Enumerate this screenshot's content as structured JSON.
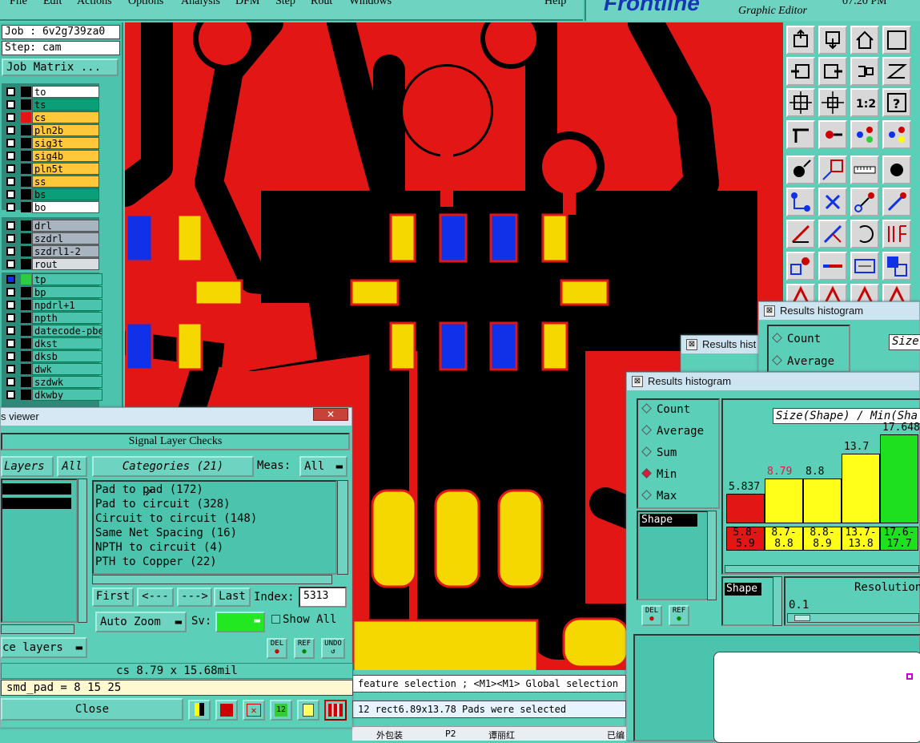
{
  "menu": {
    "items": [
      "File",
      "Edit",
      "Actions",
      "Options",
      "Analysis",
      "DFM",
      "Step",
      "Rout",
      "Windows"
    ],
    "help": "Help"
  },
  "brand": {
    "logo": "Frontline",
    "subtitle": "Graphic Editor",
    "time": "07:20 PM"
  },
  "job": {
    "job_label": "Job : 6v2g739za0",
    "step_label": "Step: cam",
    "matrix_button": "Job Matrix ..."
  },
  "layers_group1": [
    {
      "name": "to",
      "color": "#ffffff",
      "mark": ""
    },
    {
      "name": "ts",
      "color": "#0a9f78",
      "mark": ""
    },
    {
      "name": "cs",
      "color": "#ffc83a",
      "mark": "#e31616"
    },
    {
      "name": "pln2b",
      "color": "#ffc83a",
      "mark": ""
    },
    {
      "name": "sig3t",
      "color": "#ffc83a",
      "mark": ""
    },
    {
      "name": "sig4b",
      "color": "#ffc83a",
      "mark": ""
    },
    {
      "name": "pln5t",
      "color": "#ffc83a",
      "mark": ""
    },
    {
      "name": "ss",
      "color": "#ffc83a",
      "mark": ""
    },
    {
      "name": "bs",
      "color": "#0a9f78",
      "mark": ""
    },
    {
      "name": "bo",
      "color": "#ffffff",
      "mark": ""
    }
  ],
  "layers_group2": [
    {
      "name": "drl",
      "color": "#a8b4bf"
    },
    {
      "name": "szdrl",
      "color": "#a8b4bf"
    },
    {
      "name": "szdrl1-2",
      "color": "#a8b4bf"
    },
    {
      "name": "rout",
      "color": "#d8dde0"
    }
  ],
  "layers_group3": [
    "tp",
    "bp",
    "npdrl+1",
    "npth",
    "datecode-pbe",
    "dkst",
    "dksb",
    "dwk",
    "szdwk",
    "dkwby"
  ],
  "viewer": {
    "title_fragment": "s viewer",
    "header": "Signal Layer Checks",
    "layers_label": "Layers",
    "all_label": "All",
    "categories_label": "Categories (21)",
    "meas_label": "Meas:",
    "meas_value": "All",
    "categories": [
      "Pad to pad (172)",
      "Pad to circuit (328)",
      "Circuit to circuit (148)",
      "Same Net Spacing (16)",
      "NPTH to circuit (4)",
      "PTH to Copper (22)"
    ],
    "nav": {
      "first": "First",
      "prev": "<---",
      "next": "--->",
      "last": "Last",
      "index_label": "Index:",
      "index_value": "5313"
    },
    "auto_zoom": "Auto Zoom",
    "sv_label": "Sv:",
    "show_all": "Show All",
    "ce_layers": "ce layers",
    "measure": "cs 8.79 x 15.68mil",
    "attribute": "smd_pad = 8 15 25",
    "close": "Close",
    "del": "DEL",
    "ref": "REF",
    "undo": "UNDO"
  },
  "histogram_back": {
    "title": "Results histogram",
    "options": [
      "Count",
      "Average"
    ],
    "size_label": "Size"
  },
  "histogram_back2": {
    "title": "Results hist"
  },
  "histogram": {
    "title": "Results histogram",
    "options": [
      "Count",
      "Average",
      "Sum",
      "Min",
      "Max"
    ],
    "selected": "Min",
    "header": "Size(Shape) / Min(Sha",
    "shape_list": [
      "Shape"
    ],
    "shape_label": "Shape",
    "resolution_label": "Resolution",
    "resolution_value": "0.1",
    "del": "DEL",
    "ref": "REF"
  },
  "chart_data": {
    "type": "bar",
    "categories": [
      "5.8-5.9",
      "8.7-8.8",
      "8.8-8.9",
      "13.7-13.8",
      "17.6-17.7"
    ],
    "values": [
      5.837,
      8.79,
      8.8,
      13.7,
      17.648
    ],
    "value_labels": [
      "5.837",
      "8.79",
      "8.8",
      "13.7",
      "17.648"
    ],
    "colors": [
      "#e31616",
      "#ffff1a",
      "#ffff1a",
      "#ffff1a",
      "#1ee01e"
    ],
    "ylim": [
      0,
      19
    ]
  },
  "status": {
    "line1": "feature selection ; <M1><M1> Global selection",
    "line2": "12 rect6.89x13.78 Pads were selected"
  },
  "taskbar": {
    "items": [
      "外包装",
      "P2",
      "谭丽红",
      "已编"
    ]
  }
}
